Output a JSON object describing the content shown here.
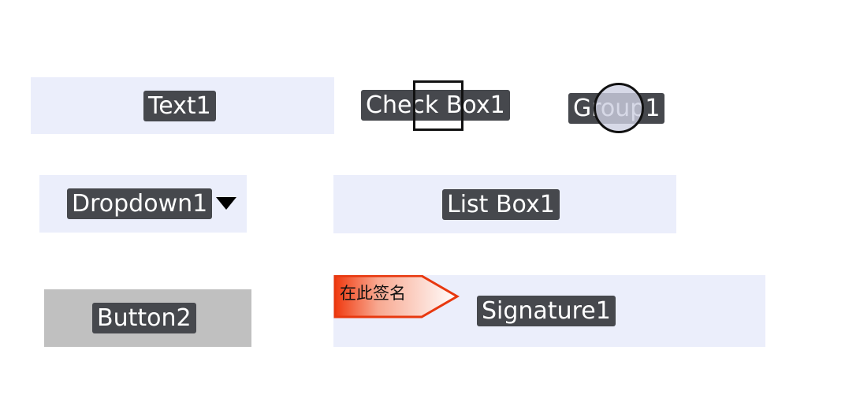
{
  "fields": {
    "text1": "Text1",
    "checkbox1": "Check Box1",
    "group1": "Group1",
    "dropdown1": "Dropdown1",
    "listbox1": "List Box1",
    "button2": "Button2",
    "signature1": "Signature1"
  },
  "sign_here": {
    "label": "在此签名",
    "icon": "sign-here-arrow-icon"
  },
  "colors": {
    "field_background": "#ebeefb",
    "button_background": "#c0c0c0",
    "label_tag_background": "#46484d",
    "sign_here_gradient_start": "#f03a10",
    "sign_here_gradient_end": "#ffffff"
  }
}
